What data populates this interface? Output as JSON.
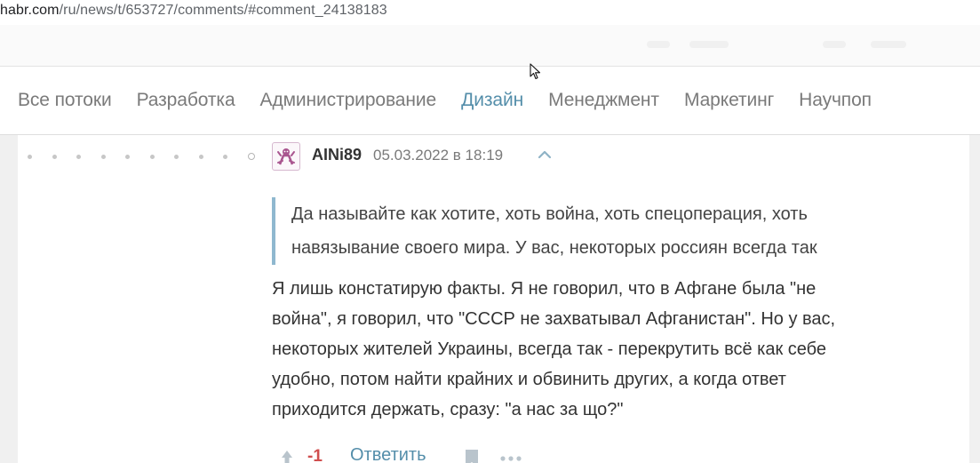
{
  "browser": {
    "url_host": "habr.com",
    "url_path": "/ru/news/t/653727/comments/#comment_24138183"
  },
  "nav": {
    "items": [
      {
        "label": "Все потоки",
        "active": false
      },
      {
        "label": "Разработка",
        "active": false
      },
      {
        "label": "Администрирование",
        "active": false
      },
      {
        "label": "Дизайн",
        "active": true
      },
      {
        "label": "Менеджмент",
        "active": false
      },
      {
        "label": "Маркетинг",
        "active": false
      },
      {
        "label": "Научпоп",
        "active": false
      }
    ],
    "active_color": "#548eaa"
  },
  "comment": {
    "username": "AINi89",
    "date": "05.03.2022 в 18:19",
    "quote": [
      "Да называйте как хотите, хоть война, хоть спецоперация, хоть",
      "навязывание своего мира. У вас, некоторых россиян всегда так"
    ],
    "body": [
      "Я лишь констатирую факты. Я не говорил, что в Афгане была \"не",
      "война\", я говорил, что \"СССР не захватывал Афганистан\". Но у вас,",
      "некоторых жителей Украины, всегда так - перекрутить всё как себе",
      "удобно, потом найти крайних и обвинить других, а когда ответ",
      "приходится держать, сразу: \"а нас за що?\""
    ],
    "score": "-1",
    "reply_label": "Ответить",
    "score_color": "#d04e4e",
    "link_color": "#548eaa",
    "quote_bar_color": "#8fb8cf"
  },
  "icons": {
    "collapse": "chevron-up-icon",
    "vote": "vote-arrow-icon",
    "bookmark": "bookmark-icon",
    "more": "more-dots-icon",
    "cursor": "mouse-cursor-icon"
  }
}
